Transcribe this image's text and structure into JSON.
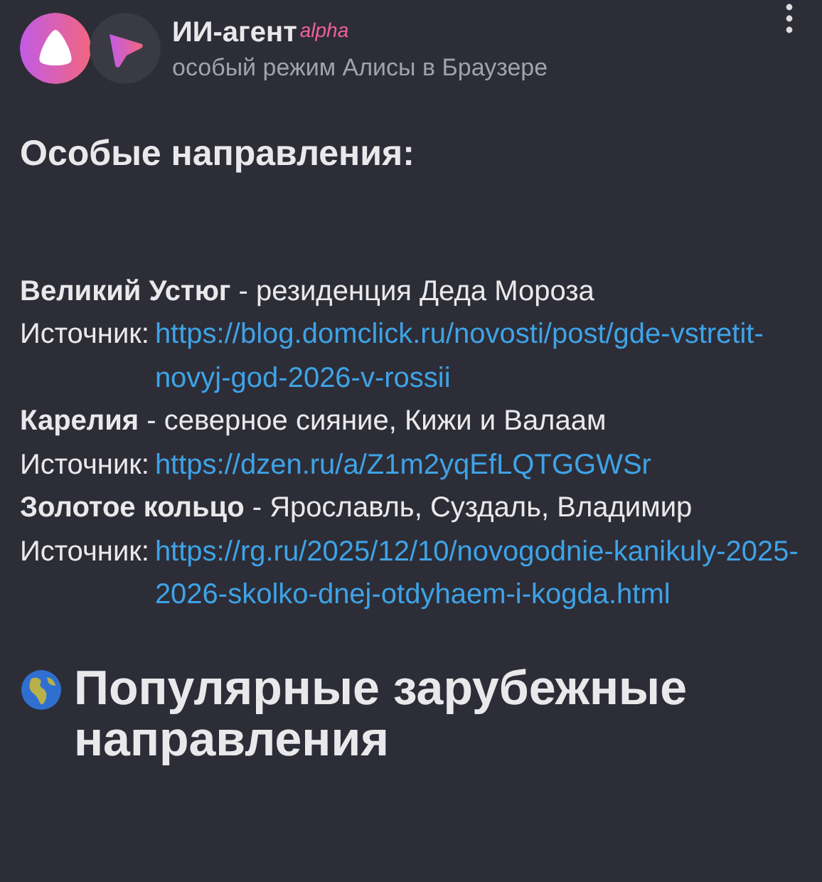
{
  "header": {
    "title": "ИИ-агент",
    "badge": "alpha",
    "subtitle": "особый режим Алисы в Браузере"
  },
  "section_title": "Особые направления:",
  "entries": [
    {
      "name": "Великий Устюг",
      "description": " - резиденция Деда Мороза",
      "source_label": "Источник:",
      "link": "https://blog.domclick.ru/novosti/post/gde-vstretit-novyj-god-2026-v-rossii"
    },
    {
      "name": "Карелия",
      "description": " - северное сияние, Кижи и Валаам",
      "source_label": "Источник:",
      "link": "https://dzen.ru/a/Z1m2yqEfLQTGGWSr"
    },
    {
      "name": "Золотое кольцо",
      "description": " - Ярославль, Суздаль, Владимир",
      "source_label": "Источник:",
      "link": "https://rg.ru/2025/12/10/novogodnie-kanikuly-2025-2026-skolko-dnej-otdyhaem-i-kogda.html"
    }
  ],
  "next_heading": "Популярные зарубежные направления"
}
